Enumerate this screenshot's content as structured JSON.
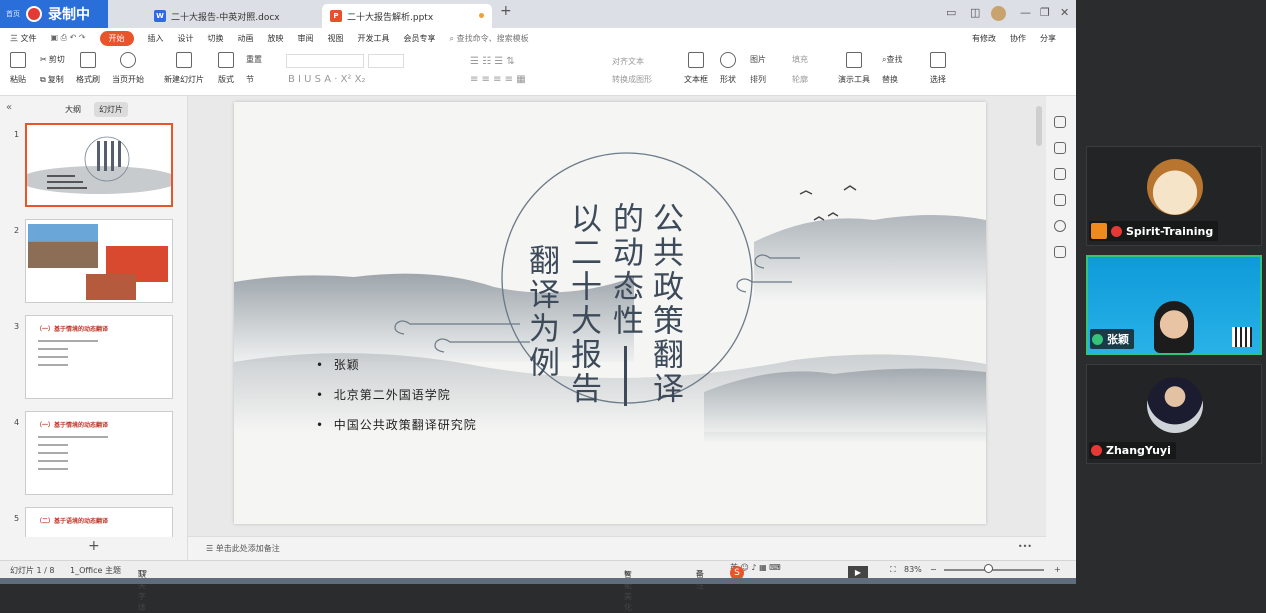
{
  "recording": {
    "label": "录制中",
    "small": "首页"
  },
  "tabs": [
    {
      "label": "二十大报告-中英对照.docx"
    },
    {
      "label": "二十大报告解析.pptx"
    }
  ],
  "menu": {
    "file": "三 文件",
    "items": [
      "开始",
      "插入",
      "设计",
      "切换",
      "动画",
      "放映",
      "审阅",
      "视图",
      "开发工具",
      "会员专享"
    ],
    "search": "查找命令、搜索模板",
    "right": [
      "有修改",
      "协作",
      "分享"
    ]
  },
  "ribbon": {
    "paste": "粘贴",
    "cut": "剪切",
    "copy": "复制",
    "format_painter": "格式刷",
    "from_start": "当页开始",
    "new_slide": "新建幻灯片",
    "layout": "版式",
    "section": "节",
    "reset": "重置",
    "textbox": "文本框",
    "shape": "形状",
    "picture": "图片",
    "arrange": "排列",
    "fill": "填充",
    "outline": "轮廓",
    "presentation_tools": "演示工具",
    "find": "查找",
    "replace": "替换",
    "select": "选择",
    "align_text": "对齐文本",
    "convert_smartart": "转换成图形"
  },
  "left_panel": {
    "tab_outline": "大纲",
    "tab_slides": "幻灯片",
    "slide_numbers": [
      "1",
      "2",
      "3",
      "4",
      "5"
    ],
    "thumb3_title": "（一）基于情境的动态翻译",
    "thumb4_title": "（一）基于情境的动态翻译",
    "thumb5_title": "（二）基于语境的动态翻译"
  },
  "slide": {
    "title_col1": "公共政策翻译",
    "title_col2": "的动态性",
    "title_col3": "以二十大报告",
    "title_col4": "翻译为例",
    "bullets": [
      "张颖",
      "北京第二外国语学院",
      "中国公共政策翻译研究院"
    ]
  },
  "notes_placeholder": "单击此处添加备注",
  "status": {
    "slide_pos": "幻灯片 1 / 8",
    "theme": "1_Office 主题",
    "font_missing": "缺失字体",
    "beautify": "智能美化",
    "notes": "备注",
    "zoom": "83%"
  },
  "participants": [
    {
      "name": "Spirit-Training",
      "muted": true
    },
    {
      "name": "张颖",
      "muted": false,
      "speaking": true
    },
    {
      "name": "ZhangYuyi",
      "muted": true
    }
  ],
  "colors": {
    "accent": "#e8552a",
    "active_speaker": "#35c27b",
    "ink": "#3d4a5a"
  }
}
